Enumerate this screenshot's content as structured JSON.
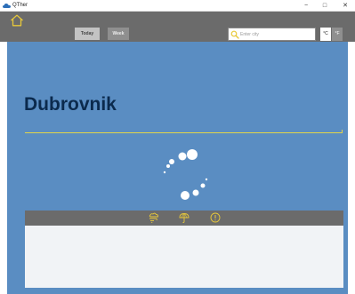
{
  "window": {
    "title": "QTher",
    "minimize_glyph": "−",
    "maximize_glyph": "□",
    "close_glyph": "✕"
  },
  "toolbar": {
    "today_label": "Today",
    "week_label": "Week",
    "search_placeholder": "Enter city",
    "search_value": "",
    "unit_celsius": "°C",
    "unit_fahrenheit": "°F"
  },
  "city": {
    "name": "Dubrovnik"
  },
  "panel": {
    "icons": [
      "wind-rain-icon",
      "umbrella-icon",
      "info-icon"
    ]
  },
  "colors": {
    "accent": "#e2d64a",
    "toolbar_bg": "#6b6b6b",
    "main_bg": "#5a8dc2",
    "city_text": "#0b2a4d",
    "panel_body": "#f1f3f6"
  }
}
